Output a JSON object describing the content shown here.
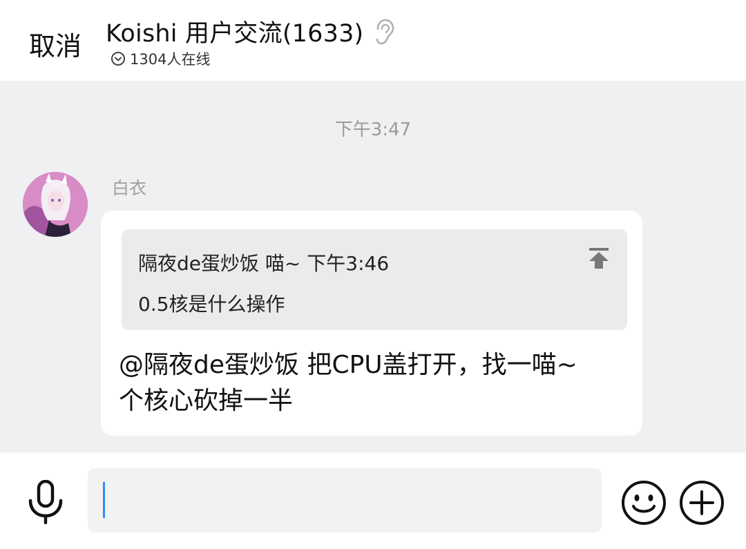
{
  "header": {
    "cancel_label": "取消",
    "title": "Koishi 用户交流(1633)",
    "online_text": "1304人在线",
    "title_icon": "ear-icon",
    "online_icon": "chevron-down-circle-icon"
  },
  "chat": {
    "timestamp": "下午3:47",
    "messages": [
      {
        "sender": "白衣",
        "avatar": "avatar",
        "quote": {
          "header": "隔夜de蛋炒饭 喵~ 下午3:46",
          "body": "0.5核是什么操作",
          "jump_icon": "jump-to-top-icon"
        },
        "text_line1": "@隔夜de蛋炒饭  把CPU盖打开，找一喵~",
        "text_line2": "个核心砍掉一半"
      }
    ]
  },
  "input_bar": {
    "value": "",
    "icons": [
      "mic-icon",
      "emoji-icon",
      "plus-icon"
    ],
    "cursor_color": "#2d8cf0"
  },
  "colors": {
    "background": "#f0f0f2",
    "bubble": "#ffffff",
    "quote_bg": "#ebebed",
    "muted_text": "#9a9a9a"
  }
}
